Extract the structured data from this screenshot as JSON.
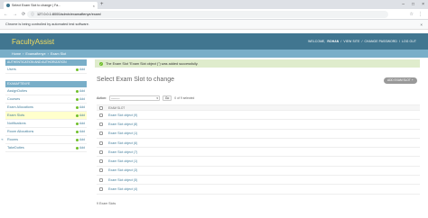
{
  "browser": {
    "tab_title": "Select Exam Slot to change | Fa...",
    "tab_close": "×",
    "new_tab": "+",
    "window_controls": [
      "–",
      "□",
      "×"
    ],
    "nav_buttons": [
      "←",
      "→",
      "⟳"
    ],
    "url": "127.0.0.1:8000/admin/examaftenye/exam/",
    "actions_icons": [
      "☆",
      "⋮"
    ],
    "infobar_text": "Chrome is being controlled by automated test software.",
    "infobar_close": "×"
  },
  "header": {
    "branding": "FacultyAssist",
    "welcome": "WELCOME,",
    "username": "ROHAN",
    "view_site": "VIEW SITE",
    "change_password": "CHANGE PASSWORD",
    "logout": "LOG OUT",
    "sep": "/"
  },
  "breadcrumbs": {
    "home": "Home",
    "app": "Examaftenye",
    "current": "Exam Slot",
    "sep": "›"
  },
  "sidebar": {
    "groups": [
      {
        "caption": "Authentication and Authorization",
        "items": [
          {
            "label": "Users",
            "add": "Add"
          }
        ]
      },
      {
        "caption": "Examaftenye",
        "items": [
          {
            "label": "AssignDuties",
            "add": "Add"
          },
          {
            "label": "Courses",
            "add": "Add"
          },
          {
            "label": "Exam Allocations",
            "add": "Add"
          },
          {
            "label": "Exam Slots",
            "add": "Add"
          },
          {
            "label": "Notifications",
            "add": "Add"
          },
          {
            "label": "Room Allocations",
            "add": "Add"
          },
          {
            "label": "Rooms",
            "add": "Add"
          },
          {
            "label": "TakeDuties",
            "add": "Add"
          }
        ]
      }
    ],
    "toggle_icon": "«"
  },
  "content": {
    "success_message": "The Exam Slot \"Exam Slot object (\") was added successfully.",
    "page_title": "Select Exam Slot to change",
    "add_button": "ADD EXAM SLOT",
    "add_button_icon": "+",
    "action_label": "Action:",
    "action_value": "---------",
    "action_caret": "▾",
    "go_label": "Go",
    "selected_count": "0 of 9 selected",
    "column_header": "EXAM SLOT",
    "rows": [
      "Exam Slot object (9)",
      "Exam Slot object (8)",
      "Exam Slot object (1)",
      "Exam Slot object (6)",
      "Exam Slot object (7)",
      "Exam Slot object (1)",
      "Exam Slot object (3)",
      "Exam Slot object (5)",
      "Exam Slot object (4)"
    ],
    "paginator": "9 Exam Slots"
  },
  "colors": {
    "header_bg": "#417690",
    "branding": "#f5dd5d",
    "breadcrumb_bg": "#79aec8",
    "link": "#447e9b",
    "success_bg": "#dfeccc",
    "add_icon": "#70bf2b",
    "active_row": "#ffffcc"
  }
}
